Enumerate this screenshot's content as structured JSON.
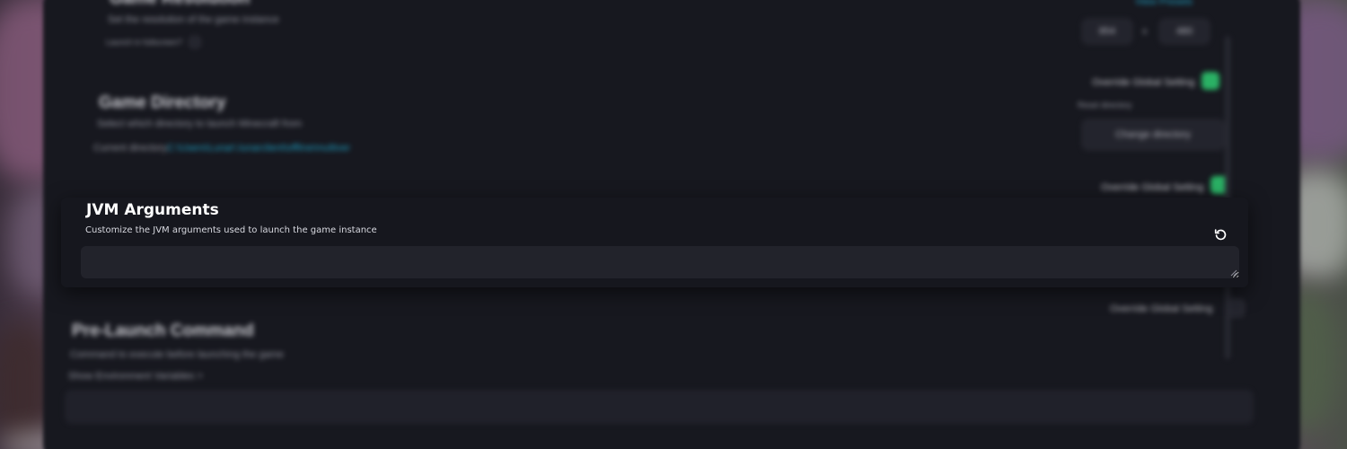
{
  "background_panel": {
    "resolution": {
      "title": "Game Resolution",
      "description": "Set the resolution of the game instance",
      "launch_label": "Launch in fullscreen?",
      "width": "854",
      "separator": "x",
      "height": "480",
      "link": "View Presets"
    },
    "directory": {
      "override_label": "Override Global Setting",
      "title": "Game Directory",
      "description": "Select which directory to launch Minecraft from",
      "current_label": "Current directory:",
      "current_path": "C:\\Users\\Lunar\\.lunarclient\\offline\\multiver",
      "reset_label": "Reset directory",
      "change_button": "Change directory"
    },
    "jvm_override_label": "Override Global Setting",
    "prelaunch": {
      "override_label": "Override Global Setting",
      "title": "Pre-Launch Command",
      "description": "Command to execute before launching the game",
      "env_link": "Show Environment Variables >"
    }
  },
  "jvm_card": {
    "title": "JVM Arguments",
    "description": "Customize the JVM arguments used to launch the game instance",
    "input_value": "",
    "input_placeholder": ""
  },
  "icons": {
    "reset": "reset-icon",
    "folder": "folder-icon",
    "external_link": "external-link-icon",
    "checkbox": "checkbox-icon"
  },
  "colors": {
    "accent_green": "#2ecc71",
    "link_cyan": "#1fb7e0",
    "card_bg": "#16171e",
    "input_bg": "#22232b"
  }
}
